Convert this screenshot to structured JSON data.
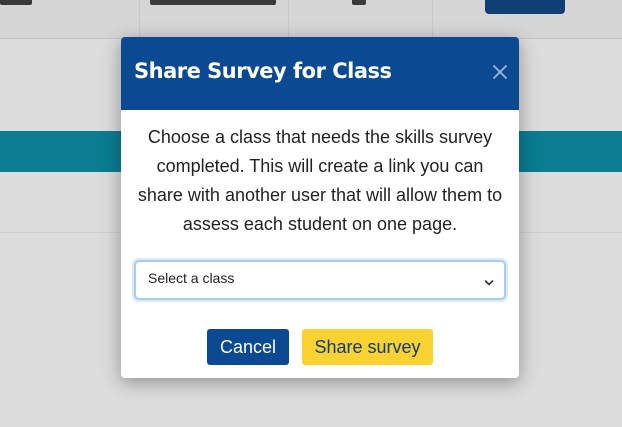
{
  "modal": {
    "title": "Share Survey for Class",
    "close_icon": "close-icon",
    "description": "Choose a class that needs the skills survey completed. This will create a link you can share with another user that will allow them to assess each student on one page.",
    "class_select": {
      "selected_value": "Select a class",
      "chevron_icon": "chevron-down-icon"
    },
    "actions": {
      "cancel_label": "Cancel",
      "share_label": "Share survey"
    }
  },
  "colors": {
    "header_bg": "#0b4a93",
    "cancel_bg": "#0b4a93",
    "share_bg": "#fad232",
    "backdrop": "#dcdcdc",
    "banner": "#0a7d92"
  }
}
